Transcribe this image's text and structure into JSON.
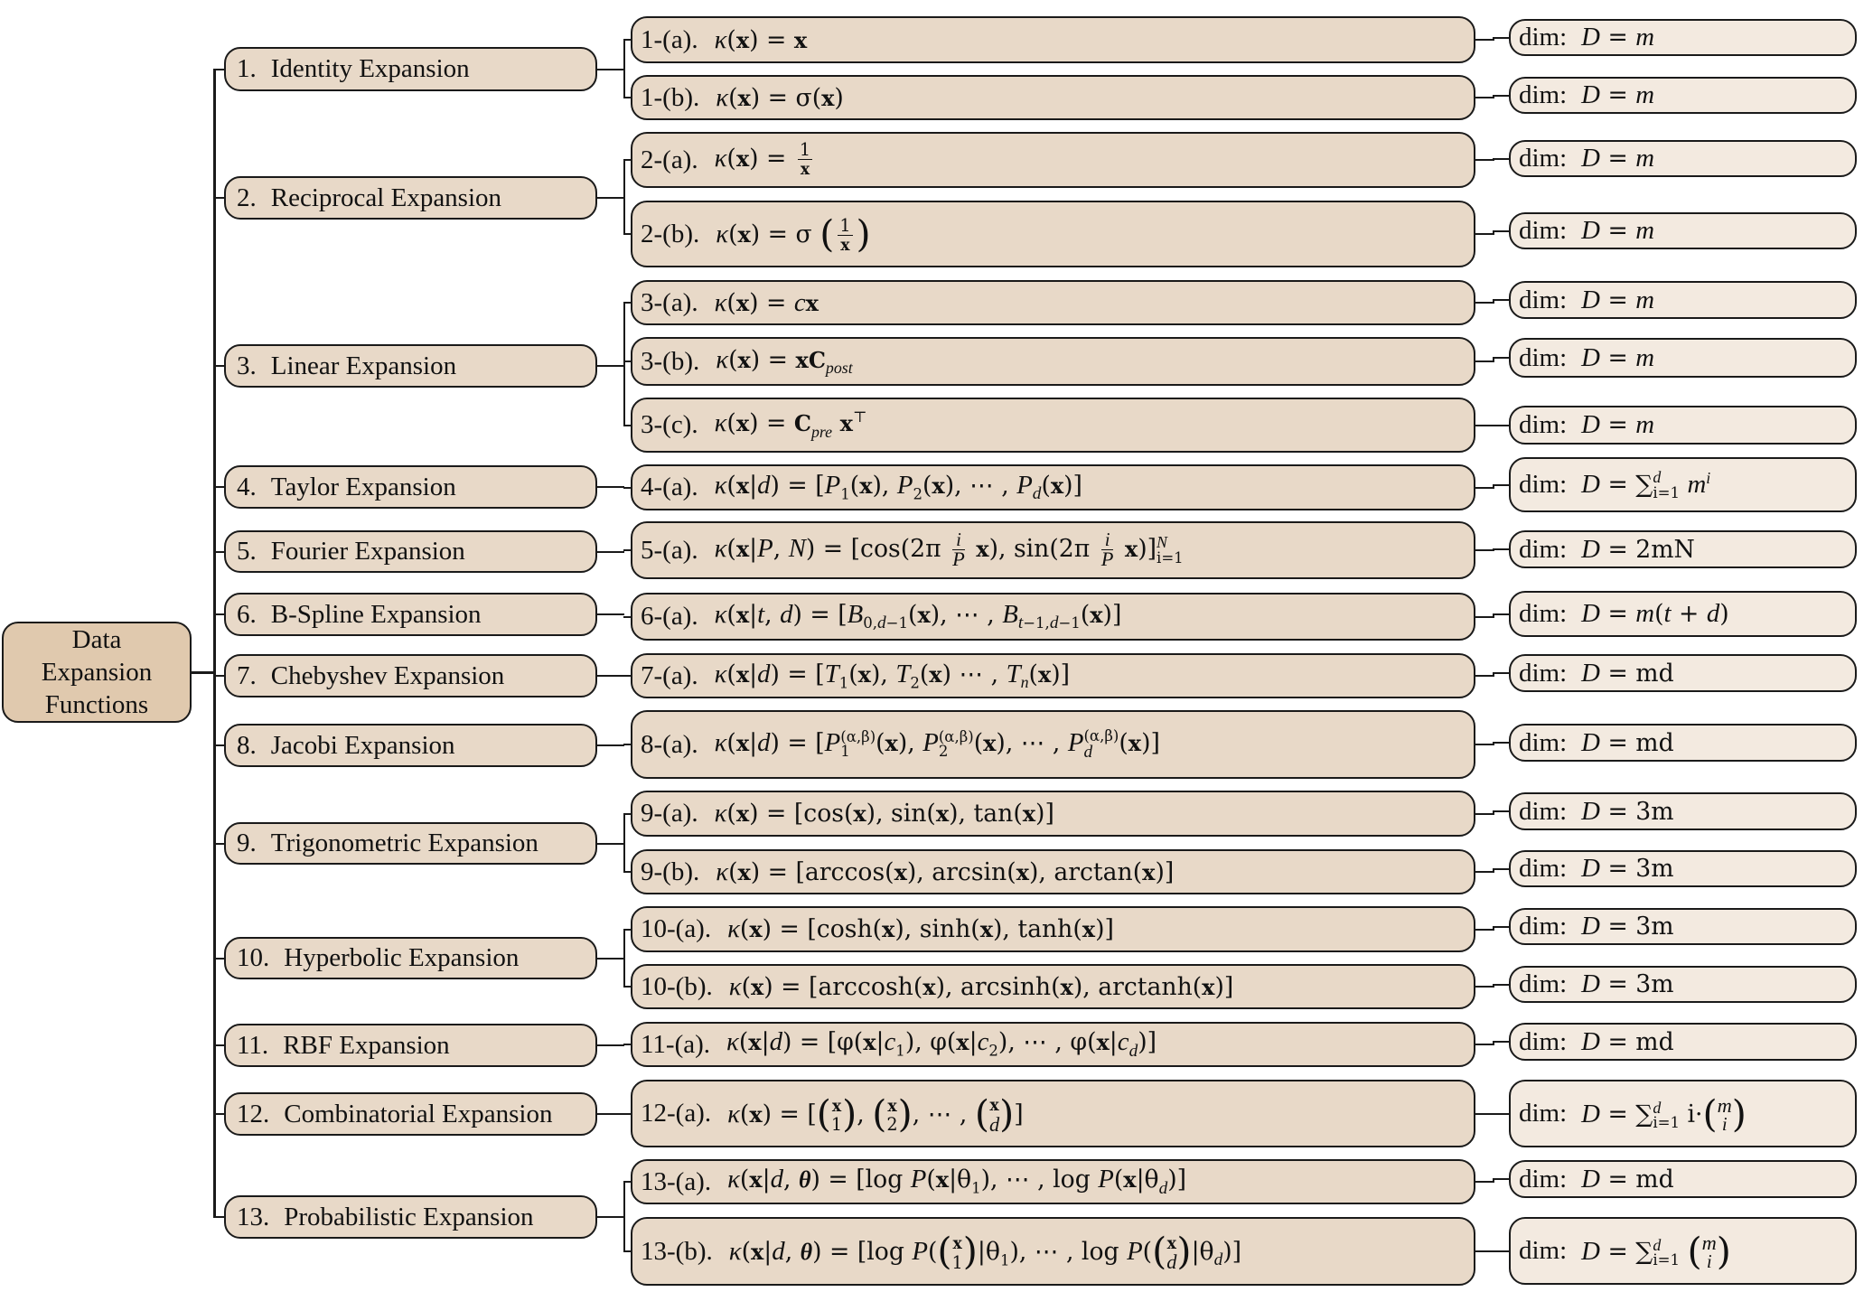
{
  "root": {
    "lines": [
      "Data",
      "Expansion",
      "Functions"
    ]
  },
  "categories": [
    {
      "num": "1.",
      "label": "Identity Expansion",
      "items": [
        {
          "tag": "1-(a).",
          "formula": "κ(𝐱) = 𝐱",
          "dim": "D = m"
        },
        {
          "tag": "1-(b).",
          "formula": "κ(𝐱) = σ(𝐱)",
          "dim": "D = m"
        }
      ]
    },
    {
      "num": "2.",
      "label": "Reciprocal Expansion",
      "items": [
        {
          "tag": "2-(a).",
          "formula": "κ(𝐱) = 1/𝐱",
          "dim": "D = m"
        },
        {
          "tag": "2-(b).",
          "formula": "κ(𝐱) = σ(1/𝐱)",
          "dim": "D = m"
        }
      ]
    },
    {
      "num": "3.",
      "label": "Linear Expansion",
      "items": [
        {
          "tag": "3-(a).",
          "formula": "κ(𝐱) = c𝐱",
          "dim": "D = m"
        },
        {
          "tag": "3-(b).",
          "formula": "κ(𝐱) = 𝐱𝐂_post",
          "dim": "D = m"
        },
        {
          "tag": "3-(c).",
          "formula": "κ(𝐱) = 𝐂_pre 𝐱^⊤",
          "dim": "D = m"
        }
      ]
    },
    {
      "num": "4.",
      "label": "Taylor Expansion",
      "items": [
        {
          "tag": "4-(a).",
          "formula": "κ(𝐱|d) = [P_1(𝐱), P_2(𝐱), ⋯ , P_d(𝐱)]",
          "dim": "D = ∑_{i=1}^{d} m^i"
        }
      ]
    },
    {
      "num": "5.",
      "label": "Fourier Expansion",
      "items": [
        {
          "tag": "5-(a).",
          "formula": "κ(𝐱|P, N) = [cos(2π (i/P) 𝐱), sin(2π (i/P) 𝐱)]_{i=1}^{N}",
          "dim": "D = 2mN"
        }
      ]
    },
    {
      "num": "6.",
      "label": "B-Spline Expansion",
      "items": [
        {
          "tag": "6-(a).",
          "formula": "κ(𝐱|t, d) = [B_{0,d−1}(𝐱), ⋯ , B_{t−1,d−1}(𝐱)]",
          "dim": "D = m(t + d)"
        }
      ]
    },
    {
      "num": "7.",
      "label": "Chebyshev Expansion",
      "items": [
        {
          "tag": "7-(a).",
          "formula": "κ(𝐱|d) = [T_1(𝐱), T_2(𝐱) ⋯ , T_n(𝐱)]",
          "dim": "D = md"
        }
      ]
    },
    {
      "num": "8.",
      "label": "Jacobi Expansion",
      "items": [
        {
          "tag": "8-(a).",
          "formula": "κ(𝐱|d) = [P_1^{(α,β)}(𝐱), P_2^{(α,β)}(𝐱), ⋯ , P_d^{(α,β)}(𝐱)]",
          "dim": "D = md"
        }
      ]
    },
    {
      "num": "9.",
      "label": "Trigonometric Expansion",
      "items": [
        {
          "tag": "9-(a).",
          "formula": "κ(𝐱) = [cos(𝐱), sin(𝐱), tan(𝐱)]",
          "dim": "D = 3m"
        },
        {
          "tag": "9-(b).",
          "formula": "κ(𝐱) = [arccos(𝐱), arcsin(𝐱), arctan(𝐱)]",
          "dim": "D = 3m"
        }
      ]
    },
    {
      "num": "10.",
      "label": "Hyperbolic Expansion",
      "items": [
        {
          "tag": "10-(a).",
          "formula": "κ(𝐱) = [cosh(𝐱), sinh(𝐱), tanh(𝐱)]",
          "dim": "D = 3m"
        },
        {
          "tag": "10-(b).",
          "formula": "κ(𝐱) = [arccosh(𝐱), arcsinh(𝐱), arctanh(𝐱)]",
          "dim": "D = 3m"
        }
      ]
    },
    {
      "num": "11.",
      "label": "RBF Expansion",
      "items": [
        {
          "tag": "11-(a).",
          "formula": "κ(𝐱|d) = [φ(𝐱|c_1), φ(𝐱|c_2), ⋯ , φ(𝐱|c_d)]",
          "dim": "D = md"
        }
      ]
    },
    {
      "num": "12.",
      "label": "Combinatorial Expansion",
      "items": [
        {
          "tag": "12-(a).",
          "formula": "κ(𝐱) = [(𝐱 choose 1), (𝐱 choose 2), ⋯ , (𝐱 choose d)]",
          "dim": "D = ∑_{i=1}^{d} i·(m choose i)"
        }
      ]
    },
    {
      "num": "13.",
      "label": "Probabilistic Expansion",
      "items": [
        {
          "tag": "13-(a).",
          "formula": "κ(𝐱|d, 𝛉) = [log P(𝐱|θ_1), ⋯ , log P(𝐱|θ_d)]",
          "dim": "D = md"
        },
        {
          "tag": "13-(b).",
          "formula": "κ(𝐱|d, 𝛉) = [log P((𝐱 choose 1)|θ_1), ⋯ , log P((𝐱 choose d)|θ_d)]",
          "dim": "D = ∑_{i=1}^{d} (m choose i)"
        }
      ]
    }
  ],
  "dim_prefix": "dim:",
  "colors": {
    "root_fill": "#e0c9ae",
    "node_fill": "#e8d9c8",
    "dim_fill": "#f3eae0",
    "stroke": "#1a1a1a"
  }
}
